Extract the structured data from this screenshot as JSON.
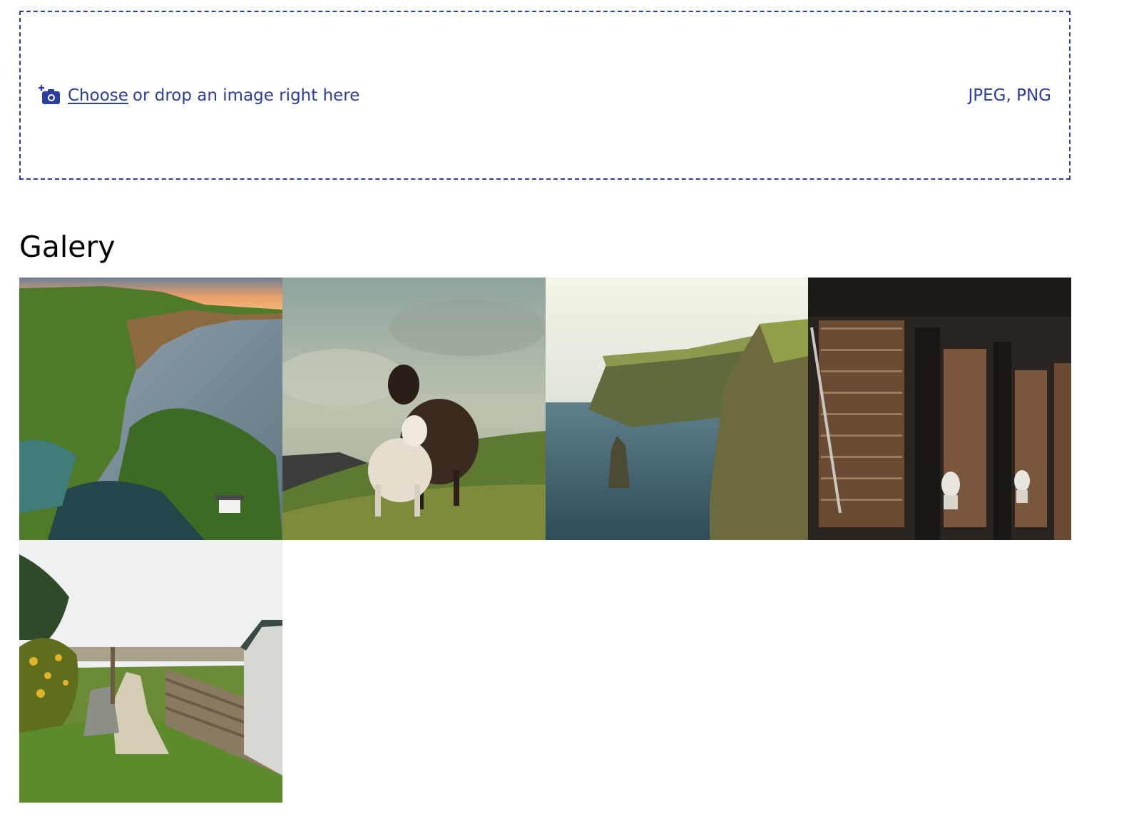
{
  "upload": {
    "choose_label": "Choose",
    "rest_label": "or drop an image right here",
    "formats": "JPEG, PNG",
    "icon": "add-photo-icon",
    "accent_color": "#2b3d9e"
  },
  "gallery": {
    "title": "Galery",
    "images": [
      {
        "subject": "coastal-cliffs-rope-bridge"
      },
      {
        "subject": "sheep-and-lamb-on-cliff"
      },
      {
        "subject": "sea-cliffs-with-sea-stack"
      },
      {
        "subject": "library-bookshelves"
      },
      {
        "subject": "countryside-path-and-cottage"
      }
    ]
  }
}
